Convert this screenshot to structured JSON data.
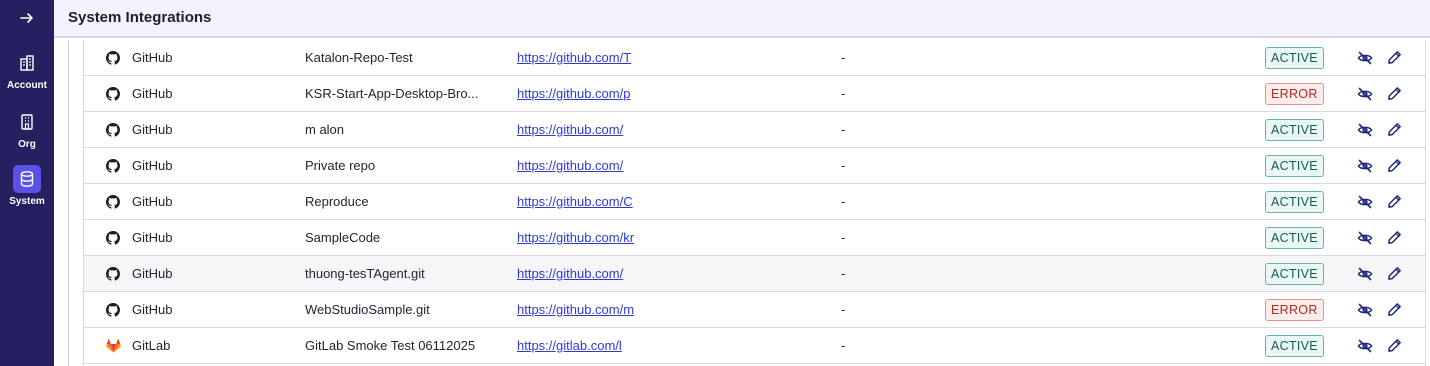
{
  "header": {
    "title": "System Integrations"
  },
  "sidebar": {
    "toggle_icon": "arrow-right-icon",
    "items": [
      {
        "label": "Account",
        "icon": "building-icon",
        "active": false
      },
      {
        "label": "Org",
        "icon": "office-building-icon",
        "active": false
      },
      {
        "label": "System",
        "icon": "database-icon",
        "active": true
      }
    ]
  },
  "colors": {
    "sidebar_bg": "#25205f",
    "sidebar_active": "#5a51e6",
    "link": "#2e3bcf",
    "active_badge": "#0f5f52",
    "error_badge": "#b02a22",
    "gitlab": "#e24329"
  },
  "integrations": [
    {
      "provider": "GitHub",
      "provider_icon": "github-icon",
      "name": "Katalon-Repo-Test",
      "url": "https://github.com/T",
      "description": "-",
      "status": "ACTIVE"
    },
    {
      "provider": "GitHub",
      "provider_icon": "github-icon",
      "name": "KSR-Start-App-Desktop-Bro...",
      "url": "https://github.com/p",
      "description": "-",
      "status": "ERROR"
    },
    {
      "provider": "GitHub",
      "provider_icon": "github-icon",
      "name": "m        alon",
      "url": "https://github.com/",
      "description": "-",
      "status": "ACTIVE"
    },
    {
      "provider": "GitHub",
      "provider_icon": "github-icon",
      "name": "Private repo",
      "url": "https://github.com/",
      "description": "-",
      "status": "ACTIVE"
    },
    {
      "provider": "GitHub",
      "provider_icon": "github-icon",
      "name": "Reproduce",
      "url": "https://github.com/C",
      "description": "-",
      "status": "ACTIVE"
    },
    {
      "provider": "GitHub",
      "provider_icon": "github-icon",
      "name": "SampleCode",
      "url": "https://github.com/kr",
      "description": "-",
      "status": "ACTIVE"
    },
    {
      "provider": "GitHub",
      "provider_icon": "github-icon",
      "name": "thuong-tesTAgent.git",
      "url": "https://github.com/",
      "description": "-",
      "status": "ACTIVE"
    },
    {
      "provider": "GitHub",
      "provider_icon": "github-icon",
      "name": "WebStudioSample.git",
      "url": "https://github.com/m",
      "description": "-",
      "status": "ERROR"
    },
    {
      "provider": "GitLab",
      "provider_icon": "gitlab-icon",
      "name": "GitLab Smoke Test 06112025",
      "url": "https://gitlab.com/l",
      "description": "-",
      "status": "ACTIVE"
    }
  ]
}
